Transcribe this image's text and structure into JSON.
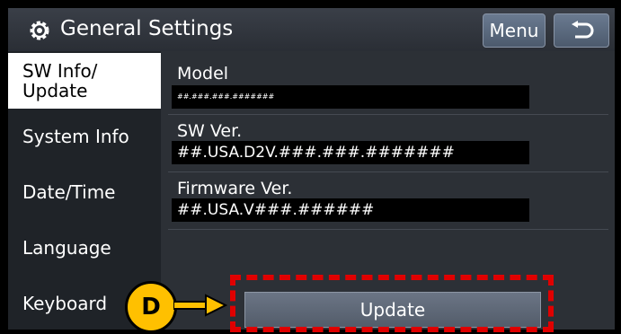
{
  "header": {
    "title": "General Settings",
    "menu_label": "Menu",
    "icon": "gear-icon",
    "back_icon": "back-arrow-icon"
  },
  "sidebar": {
    "items": [
      {
        "label": "SW Info/\nUpdate",
        "active": true
      },
      {
        "label": "System Info",
        "active": false
      },
      {
        "label": "Date/Time",
        "active": false
      },
      {
        "label": "Language",
        "active": false
      },
      {
        "label": "Keyboard",
        "active": false
      }
    ]
  },
  "main": {
    "fields": [
      {
        "label": "Model",
        "value": "##.###.###.#######"
      },
      {
        "label": "SW Ver.",
        "value": "##.USA.D2V.###.###.#######"
      },
      {
        "label": "Firmware Ver.",
        "value": "##.USA.V###.######"
      }
    ],
    "update_label": "Update"
  },
  "annotation": {
    "callout_label": "D",
    "callout_color": "#ffc000",
    "highlight_color": "#e00000"
  }
}
